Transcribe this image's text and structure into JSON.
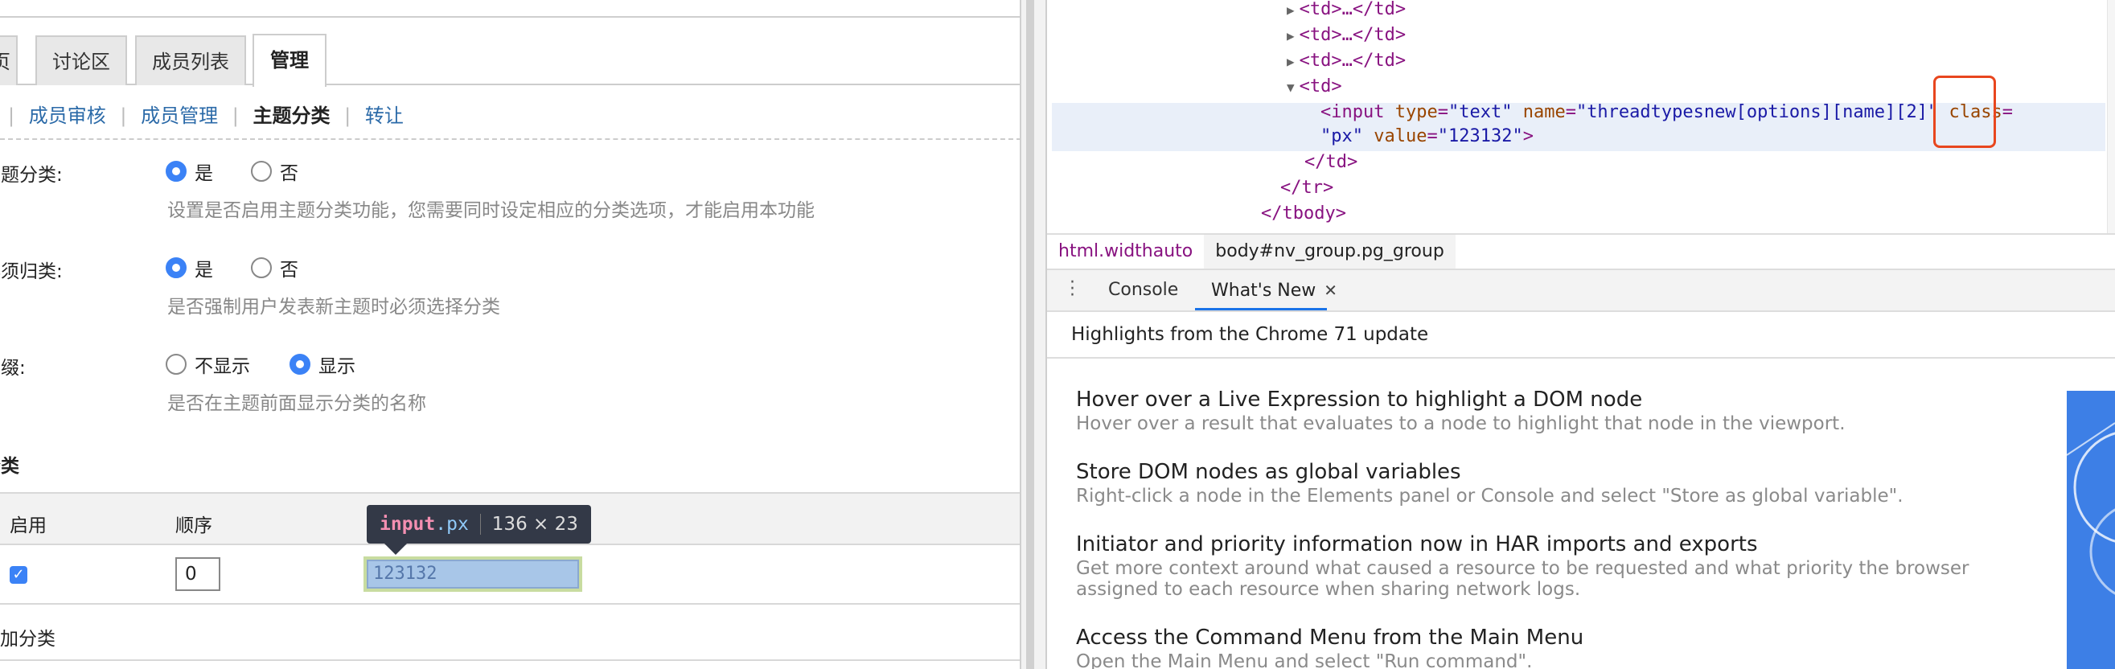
{
  "left": {
    "tabs": [
      "页",
      "讨论区",
      "成员列表",
      "管理"
    ],
    "subnav": {
      "items": [
        "成员审核",
        "成员管理",
        "主题分类",
        "转让"
      ]
    },
    "fields": [
      {
        "label": "主题分类:",
        "options": [
          "是",
          "否"
        ],
        "hint": "设置是否启用主题分类功能，您需要同时设定相应的分类选项，才能启用本功能"
      },
      {
        "label": "必须归类:",
        "options": [
          "是",
          "否"
        ],
        "hint": "是否强制用户发表新主题时必须选择分类"
      },
      {
        "label": "前缀:",
        "options": [
          "不显示",
          "显示"
        ],
        "hint": "是否在主题前面显示分类的名称"
      }
    ],
    "section_title": "分类",
    "table": {
      "headers": [
        "启用",
        "顺序"
      ],
      "row": {
        "order": "0",
        "name": "123132"
      }
    },
    "tooltip": {
      "tag": "input",
      "cls": ".px",
      "size": "136 × 23"
    },
    "add_label": "加分类"
  },
  "devtools": {
    "elements": {
      "collapsed_td": "<td>…</td>",
      "open_td": "<td>",
      "input_attrs": {
        "tag": "input",
        "type_name": "type",
        "type_val": "text",
        "name_name": "name",
        "name_val": "threadtypesnew[options][name][2]",
        "class_name": "class",
        "class_val": "px",
        "value_name": "value",
        "value_val": "123132"
      },
      "close_td": "</td>",
      "close_tr": "</tr>",
      "close_tbody": "</tbody>"
    },
    "breadcrumbs": [
      "html.widthauto",
      "body#nv_group.pg_group"
    ],
    "drawer_tabs": [
      "Console",
      "What's New"
    ],
    "whatsnew_header": "Highlights from the Chrome 71 update",
    "items": [
      {
        "title": "Hover over a Live Expression to highlight a DOM node",
        "desc": "Hover over a result that evaluates to a node to highlight that node in the viewport."
      },
      {
        "title": "Store DOM nodes as global variables",
        "desc": "Right-click a node in the Elements panel or Console and select \"Store as global variable\"."
      },
      {
        "title": "Initiator and priority information now in HAR imports and exports",
        "desc": "Get more context around what caused a resource to be requested and what priority the browser assigned to each resource when sharing network logs."
      },
      {
        "title": "Access the Command Menu from the Main Menu",
        "desc": "Open the Main Menu and select \"Run command\"."
      }
    ]
  },
  "colors": {
    "accent": "#3b82f6",
    "link": "#2b6aa8",
    "highlight_box": "#e8461e",
    "devtools_blue": "#1a73e8"
  }
}
